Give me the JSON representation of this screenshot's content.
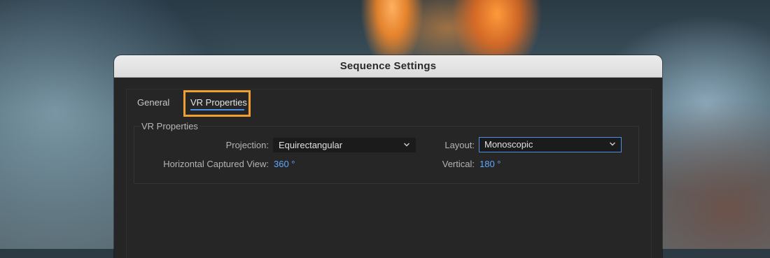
{
  "dialog": {
    "title": "Sequence Settings"
  },
  "tabs": [
    {
      "label": "General"
    },
    {
      "label": "VR Properties",
      "active": true
    }
  ],
  "vr_properties": {
    "group_label": "VR Properties",
    "projection": {
      "label": "Projection:",
      "value": "Equirectangular"
    },
    "layout": {
      "label": "Layout:",
      "value": "Monoscopic"
    },
    "horizontal_captured_view": {
      "label": "Horizontal Captured View:",
      "value": "360 °"
    },
    "vertical": {
      "label": "Vertical:",
      "value": "180 °"
    }
  },
  "icons": {
    "dropdown": "chevron-down-icon"
  },
  "colors": {
    "accent_blue": "#4a8fe8",
    "value_blue": "#5ea8ff",
    "highlight_orange": "#f0a030"
  }
}
